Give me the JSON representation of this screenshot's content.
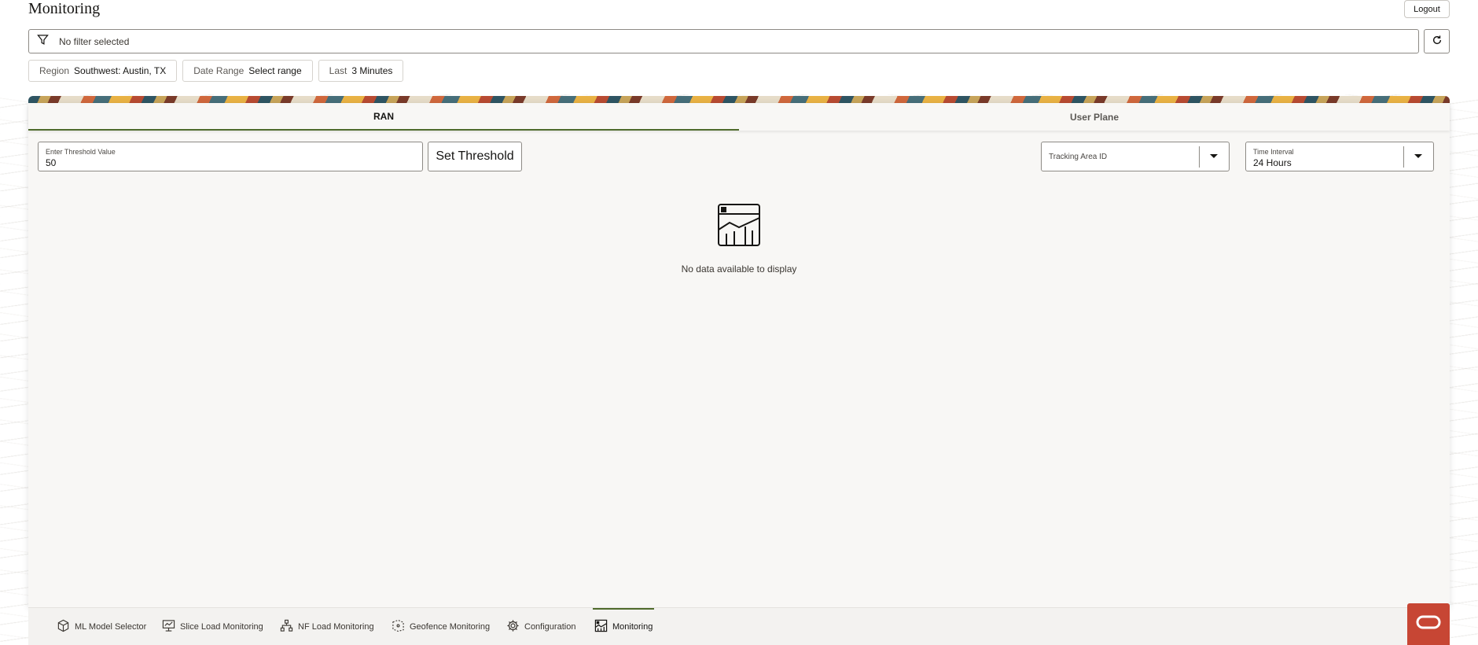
{
  "page": {
    "title": "Monitoring",
    "logout_label": "Logout"
  },
  "filter": {
    "placeholder": "No filter selected"
  },
  "chips": [
    {
      "key": "Region",
      "value": "Southwest: Austin, TX"
    },
    {
      "key": "Date Range",
      "value": "Select range"
    },
    {
      "key": "Last",
      "value": "3 Minutes"
    }
  ],
  "tabs": [
    {
      "label": "RAN",
      "active": true
    },
    {
      "label": "User Plane",
      "active": false
    }
  ],
  "threshold": {
    "label": "Enter Threshold Value",
    "value": "50",
    "button_label": "Set Threshold"
  },
  "tracking_area": {
    "placeholder": "Tracking Area ID"
  },
  "time_interval": {
    "label": "Time Interval",
    "value": "24 Hours"
  },
  "empty_state": {
    "message": "No data available to display"
  },
  "bottom_nav": [
    {
      "label": "ML Model Selector",
      "icon": "cube-icon"
    },
    {
      "label": "Slice Load Monitoring",
      "icon": "monitor-icon"
    },
    {
      "label": "NF Load Monitoring",
      "icon": "network-icon"
    },
    {
      "label": "Geofence Monitoring",
      "icon": "geofence-icon"
    },
    {
      "label": "Configuration",
      "icon": "gear-icon"
    },
    {
      "label": "Monitoring",
      "icon": "chart-icon",
      "active": true
    }
  ],
  "colors": {
    "accent": "#4f6b2c",
    "brand": "#c74634"
  }
}
